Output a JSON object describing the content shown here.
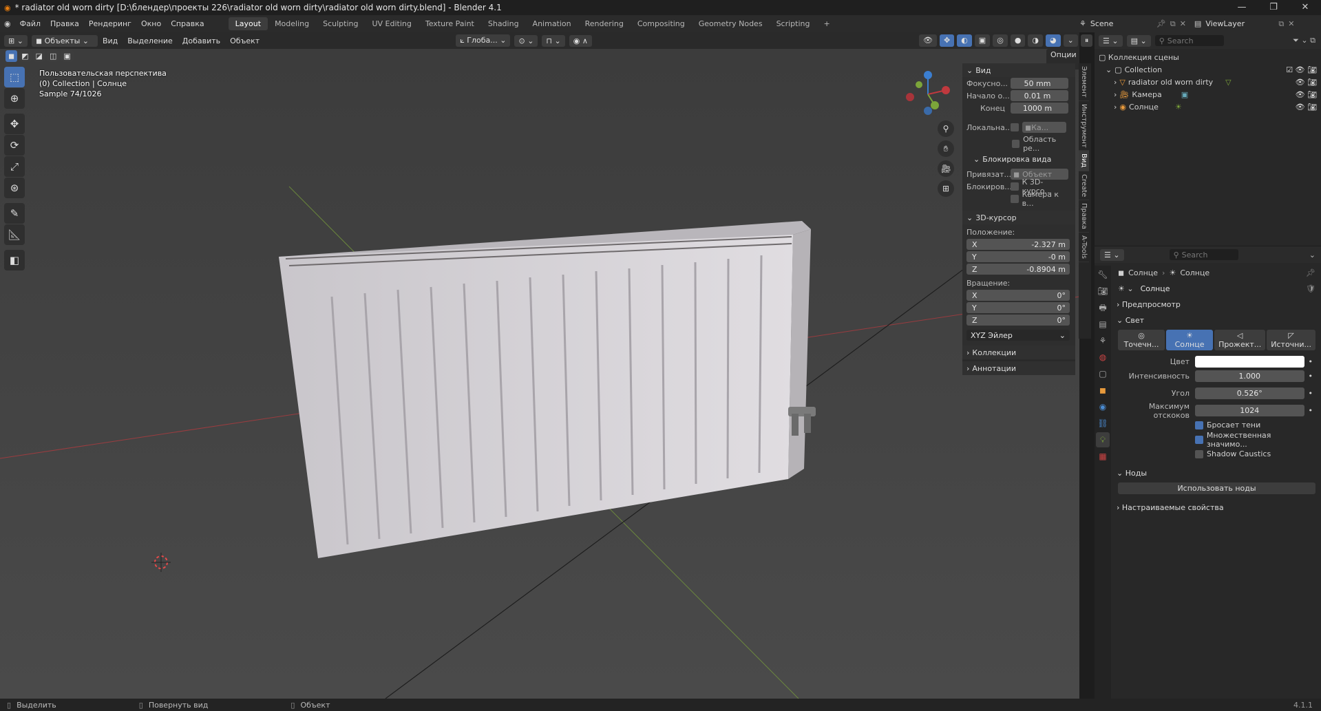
{
  "window": {
    "title": "* radiator old worn dirty [D:\\блендер\\проекты 226\\radiator old worn dirty\\radiator old worn dirty.blend] - Blender 4.1",
    "minimize": "—",
    "maximize": "❐",
    "close": "✕"
  },
  "menu": {
    "items": [
      "Файл",
      "Правка",
      "Рендеринг",
      "Окно",
      "Справка"
    ]
  },
  "workspaces": [
    "Layout",
    "Modeling",
    "Sculpting",
    "UV Editing",
    "Texture Paint",
    "Shading",
    "Animation",
    "Rendering",
    "Compositing",
    "Geometry Nodes",
    "Scripting"
  ],
  "active_workspace": "Layout",
  "scene": {
    "name": "Scene",
    "view_layer": "ViewLayer"
  },
  "viewport_header": {
    "mode": "Объекты",
    "menus": [
      "Вид",
      "Выделение",
      "Добавить",
      "Объект"
    ],
    "transform": "Глоба...",
    "options": "Опции"
  },
  "overlay": {
    "line1": "Пользовательская перспектива",
    "line2": "(0) Collection | Солнце",
    "line3": "Sample 74/1026"
  },
  "npanel": {
    "view_header": "Вид",
    "focal_label": "Фокусно...",
    "focal_value": "50 mm",
    "clip_start_label": "Начало о...",
    "clip_start_value": "0.01 m",
    "clip_end_label": "Конец",
    "clip_end_value": "1000 m",
    "local_label": "Локальна...",
    "local_camera": "Ка...",
    "render_region": "Область ре...",
    "lock_header": "Блокировка вида",
    "lock_to_label": "Привязат...",
    "lock_to_value": "Объект",
    "lock_label": "Блокиров...",
    "lock_cursor": "К 3D-курсо...",
    "lock_camera": "Камера к в...",
    "cursor_header": "3D-курсор",
    "location_label": "Положение:",
    "loc": [
      {
        "axis": "X",
        "value": "-2.327 m"
      },
      {
        "axis": "Y",
        "value": "-0 m"
      },
      {
        "axis": "Z",
        "value": "-0.8904 m"
      }
    ],
    "rotation_label": "Вращение:",
    "rot": [
      {
        "axis": "X",
        "value": "0°"
      },
      {
        "axis": "Y",
        "value": "0°"
      },
      {
        "axis": "Z",
        "value": "0°"
      }
    ],
    "rotation_mode": "XYZ Эйлер",
    "collections": "Коллекции",
    "annotations": "Аннотации"
  },
  "vtabs": [
    "Элемент",
    "Инструмент",
    "Вид",
    "Create",
    "Правка",
    "A-Tools"
  ],
  "outliner": {
    "search_placeholder": "Search",
    "root": "Коллекция сцены",
    "collection": "Collection",
    "items": [
      "radiator old worn dirty",
      "Камера",
      "Солнце"
    ]
  },
  "properties": {
    "search_placeholder": "Search",
    "breadcrumb_obj": "Солнце",
    "breadcrumb_data": "Солнце",
    "datablock": "Солнце",
    "preview": "Предпросмотр",
    "light": "Свет",
    "light_types": [
      "Точечн...",
      "Солнце",
      "Прожект...",
      "Источни..."
    ],
    "color_label": "Цвет",
    "color_value": "#ffffff",
    "strength_label": "Интенсивность",
    "strength_value": "1.000",
    "angle_label": "Угол",
    "angle_value": "0.526°",
    "bounces_label": "Максимум отскоков",
    "bounces_value": "1024",
    "cast_shadow": "Бросает тени",
    "multiple_importance": "Множественная значимо...",
    "caustics": "Shadow Caustics",
    "nodes": "Ноды",
    "use_nodes": "Использовать ноды",
    "custom_props": "Настраиваемые свойства"
  },
  "status": {
    "select": "Выделить",
    "rotate": "Повернуть вид",
    "object": "Объект",
    "version": "4.1.1"
  },
  "colors": {
    "accent": "#4772b3",
    "viewport_bg": "#3f3f3f",
    "x_axis": "#c0393e",
    "y_axis": "#7ca53a",
    "z_axis": "#3b7ed0"
  }
}
